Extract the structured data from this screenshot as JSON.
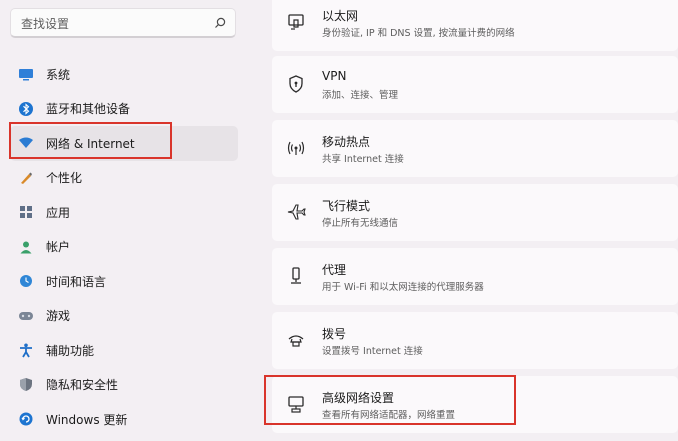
{
  "search": {
    "placeholder": "查找设置",
    "icon": "search-icon"
  },
  "sidebar": {
    "items": [
      {
        "label": "系统",
        "icon": "monitor-icon",
        "color": "#2f7fd8"
      },
      {
        "label": "蓝牙和其他设备",
        "icon": "bluetooth-icon",
        "color": "#1d74d0"
      },
      {
        "label": "网络 & Internet",
        "icon": "wifi-icon",
        "color": "#2b7cd3",
        "selected": true
      },
      {
        "label": "个性化",
        "icon": "pencil-icon",
        "color": "#d98a2a"
      },
      {
        "label": "应用",
        "icon": "apps-icon",
        "color": "#5f6f87"
      },
      {
        "label": "帐户",
        "icon": "person-icon",
        "color": "#3aa06a"
      },
      {
        "label": "时间和语言",
        "icon": "globe-clock-icon",
        "color": "#2f86d6"
      },
      {
        "label": "游戏",
        "icon": "gamepad-icon",
        "color": "#7b8696"
      },
      {
        "label": "辅助功能",
        "icon": "accessibility-icon",
        "color": "#1f6fc8"
      },
      {
        "label": "隐私和安全性",
        "icon": "shield-icon",
        "color": "#6c7480"
      },
      {
        "label": "Windows 更新",
        "icon": "update-icon",
        "color": "#1d74d0"
      }
    ]
  },
  "settings": [
    {
      "title": "以太网",
      "subtitle": "身份验证, IP 和 DNS 设置, 按流量计费的网络",
      "icon": "ethernet-icon"
    },
    {
      "title": "VPN",
      "subtitle": "添加、连接、管理",
      "icon": "vpn-shield-icon"
    },
    {
      "title": "移动热点",
      "subtitle": "共享 Internet 连接",
      "icon": "hotspot-icon"
    },
    {
      "title": "飞行模式",
      "subtitle": "停止所有无线通信",
      "icon": "airplane-icon"
    },
    {
      "title": "代理",
      "subtitle": "用于 Wi-Fi 和以太网连接的代理服务器",
      "icon": "proxy-icon"
    },
    {
      "title": "拨号",
      "subtitle": "设置拨号 Internet 连接",
      "icon": "dialup-icon"
    },
    {
      "title": "高级网络设置",
      "subtitle": "查看所有网络适配器，网络重置",
      "icon": "advanced-network-icon"
    }
  ]
}
